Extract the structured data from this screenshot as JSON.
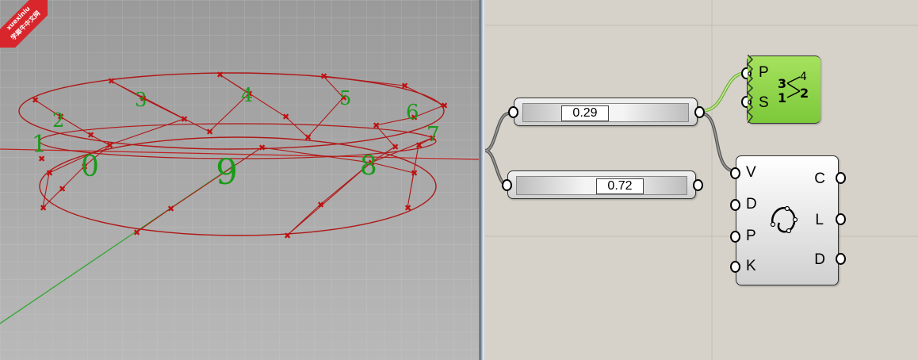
{
  "watermark": {
    "line1": "xuexiniu",
    "line2": "学犀牛中文网"
  },
  "viewport": {
    "point_labels": [
      "0",
      "1",
      "2",
      "3",
      "4",
      "5",
      "6",
      "7",
      "8",
      "9"
    ],
    "colors": {
      "curve": "#b01818",
      "labels": "#1a9a1a",
      "axis_y": "#3aa83a",
      "axis_x": "#c02020"
    }
  },
  "canvas": {
    "slider_a": {
      "value": "0.29"
    },
    "slider_b": {
      "value": "0.72"
    },
    "sort_component": {
      "inputs": [
        "P",
        "S"
      ],
      "icon": "sort-list-icon",
      "color": "#8fd64a"
    },
    "curve_component": {
      "inputs": [
        "V",
        "D",
        "P",
        "K"
      ],
      "outputs": [
        "C",
        "L",
        "D"
      ],
      "icon": "interpolate-curve-icon"
    }
  }
}
